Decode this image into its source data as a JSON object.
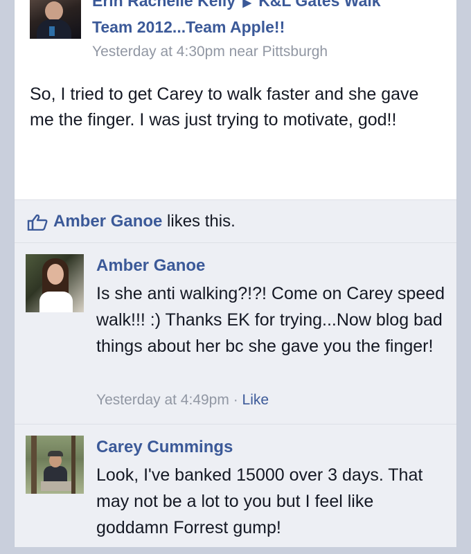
{
  "post": {
    "author": "Erin Rachelle Kelly",
    "target": "K&L Gates Walk",
    "target_line2": "Team 2012...Team Apple!!",
    "timestamp": "Yesterday at 4:30pm near Pittsburgh",
    "body": "So, I tried to get Carey to walk faster and she gave me the finger. I was just trying to motivate, god!!"
  },
  "likes": {
    "name": "Amber Ganoe",
    "suffix": "likes this."
  },
  "comments": [
    {
      "name": "Amber Ganoe",
      "text": "Is she anti walking?!?! Come on Carey speed walk!!! :) Thanks EK for trying...Now blog bad things about her bc she gave you the finger!",
      "time": "Yesterday at 4:49pm",
      "separator": " · ",
      "like_label": "Like"
    },
    {
      "name": "Carey Cummings",
      "text": "Look, I've banked 15000 over 3 days. That may not be a lot to you but I feel like goddamn Forrest gump!"
    }
  ],
  "colors": {
    "link": "#3b5998",
    "meta": "#9197a3",
    "feedback_bg": "#edeff4"
  },
  "icons": {
    "like": "thumbs-up-icon",
    "arrow": "right-triangle-icon"
  }
}
